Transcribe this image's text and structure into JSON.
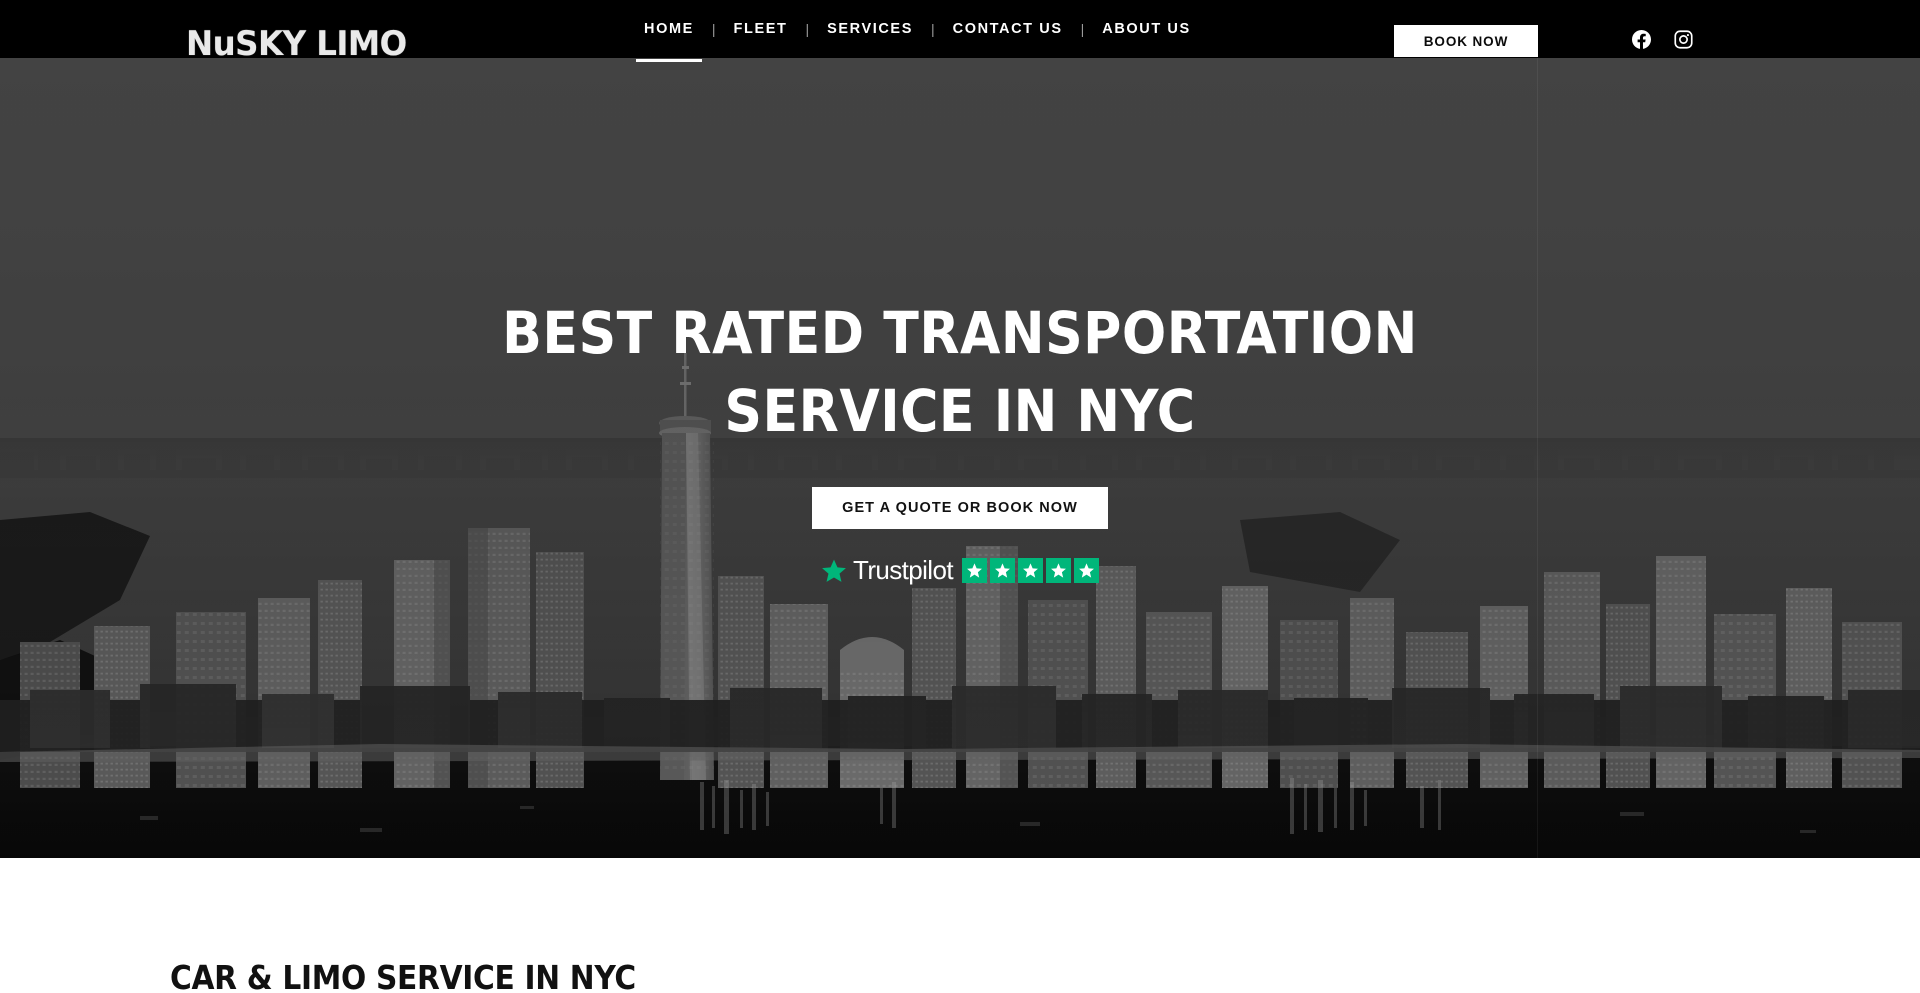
{
  "site": {
    "logo_text": "NuSKY LIMO"
  },
  "header": {
    "nav": [
      {
        "label": "HOME",
        "active": true
      },
      {
        "label": "FLEET",
        "active": false
      },
      {
        "label": "SERVICES",
        "active": false
      },
      {
        "label": "CONTACT US",
        "active": false
      },
      {
        "label": "ABOUT US",
        "active": false
      }
    ],
    "separator": "|",
    "book_now_label": "BOOK NOW",
    "socials": [
      {
        "name": "facebook-icon",
        "label": "Facebook"
      },
      {
        "name": "instagram-icon",
        "label": "Instagram"
      }
    ]
  },
  "hero": {
    "title_line1": "BEST RATED TRANSPORTATION",
    "title_line2": "SERVICE IN NYC",
    "cta_label": "GET A QUOTE OR BOOK NOW",
    "trustpilot": {
      "name": "Trustpilot",
      "stars": 5,
      "star_color": "#00b67a",
      "logo_star": "★"
    }
  },
  "main": {
    "section_title": "CAR & LIMO SERVICE IN NYC"
  },
  "colors": {
    "header_bg": "#000000",
    "accent_white": "#ffffff",
    "trustpilot_green": "#00b67a",
    "body_bg": "#ffffff",
    "hero_sky": "#5e5e5e"
  }
}
